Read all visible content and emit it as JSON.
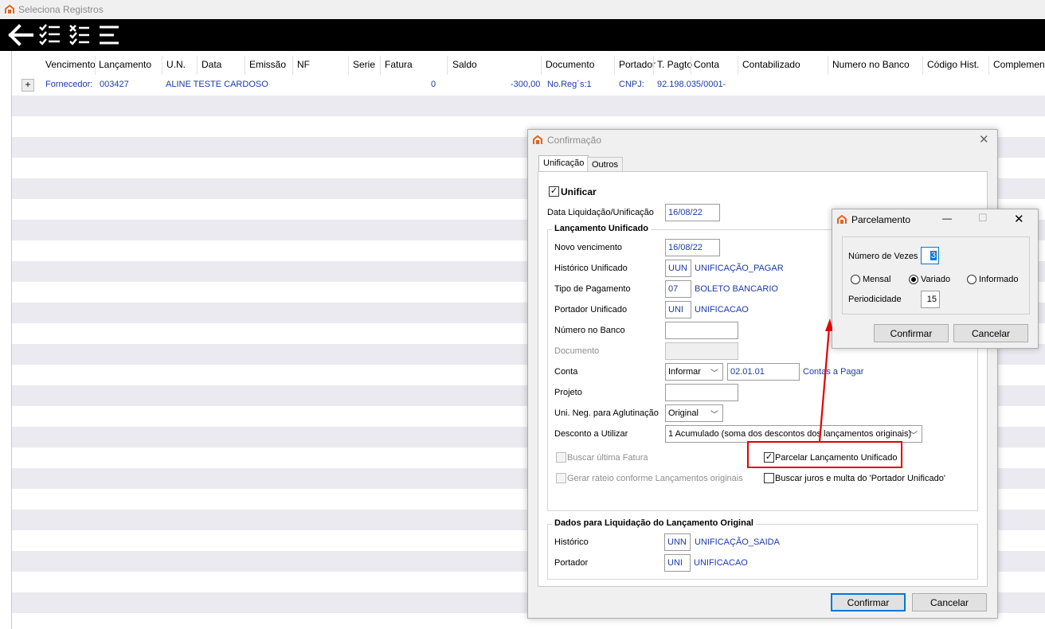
{
  "window": {
    "title": "Seleciona Registros"
  },
  "toolbar": {
    "buttons": [
      "back-icon",
      "checklist-icon",
      "uncheck-list-icon",
      "menu-icon"
    ]
  },
  "grid": {
    "columns": [
      "Vencimento",
      "Lançamento",
      "U.N.",
      "Data",
      "Emissão",
      "NF",
      "Serie",
      "Fatura",
      "Saldo",
      "Documento",
      "Portador",
      "T. Pagto",
      "Conta",
      "Contabilizado",
      "Numero no Banco",
      "Código Hist.",
      "Complemento"
    ],
    "row": {
      "expand": "+",
      "supplier_label": "Fornecedor:",
      "supplier_code": "003427",
      "supplier_name": "ALINE TESTE CARDOSO",
      "fatura": "0",
      "saldo": "-300,00",
      "documento": "No.Reg´s:1",
      "portador": "CNPJ:",
      "cnpj": "92.198.035/0001-"
    }
  },
  "dialog": {
    "title": "Confirmação",
    "close": "✕",
    "tabs": [
      "Unificação",
      "Outros"
    ],
    "unificar": {
      "label": "Unificar",
      "checked": true
    },
    "data_liquidacao": {
      "label": "Data Liquidação/Unificação",
      "value": "16/08/22"
    },
    "lancamento_group": "Lançamento Unificado",
    "novo_vencimento": {
      "label": "Novo vencimento",
      "value": "16/08/22"
    },
    "historico": {
      "label": "Histórico Unificado",
      "code": "UUN",
      "desc": "UNIFICAÇÃO_PAGAR"
    },
    "tipo_pagamento": {
      "label": "Tipo de Pagamento",
      "code": "07",
      "desc": "BOLETO BANCARIO"
    },
    "portador": {
      "label": "Portador Unificado",
      "code": "UNI",
      "desc": "UNIFICACAO"
    },
    "numero_banco": {
      "label": "Número no Banco",
      "value": ""
    },
    "documento": {
      "label": "Documento",
      "value": ""
    },
    "conta": {
      "label": "Conta",
      "select": "Informar",
      "code": "02.01.01",
      "desc": "Contas a Pagar"
    },
    "projeto": {
      "label": "Projeto",
      "value": ""
    },
    "uni_neg": {
      "label": "Uni. Neg. para Aglutinação",
      "select": "Original"
    },
    "desconto": {
      "label": "Desconto a Utilizar",
      "select": "1 Acumulado (soma dos descontos dos lançamentos originais)"
    },
    "buscar_fatura": {
      "label": "Buscar última Fatura",
      "checked": false
    },
    "parcelar": {
      "label": "Parcelar Lançamento Unificado",
      "checked": true
    },
    "gerar_rateio": {
      "label": "Gerar rateio conforme Lançamentos originais",
      "checked": false
    },
    "buscar_juros": {
      "label": "Buscar juros e multa do 'Portador Unificado'",
      "checked": false
    },
    "dados_group": "Dados para Liquidação do Lançamento Original",
    "dados_historico": {
      "label": "Histórico",
      "code": "UNN",
      "desc": "UNIFICAÇÃO_SAIDA"
    },
    "dados_portador": {
      "label": "Portador",
      "code": "UNI",
      "desc": "UNIFICACAO"
    },
    "confirm": "Confirmar",
    "cancel": "Cancelar"
  },
  "parcelamento": {
    "title": "Parcelamento",
    "minimize": "—",
    "maximize": "☐",
    "close": "✕",
    "numero_vezes": {
      "label": "Número de Vezes",
      "value": "3"
    },
    "mensal": "Mensal",
    "variado": "Variado",
    "informado": "Informado",
    "selected": "Variado",
    "periodicidade": {
      "label": "Periodicidade",
      "value": "15"
    },
    "confirm": "Confirmar",
    "cancel": "Cancelar"
  },
  "colors": {
    "accent": "#0078d7",
    "value_blue": "#1c3aa9",
    "highlight": "#e30000",
    "toolbar": "#000000"
  }
}
